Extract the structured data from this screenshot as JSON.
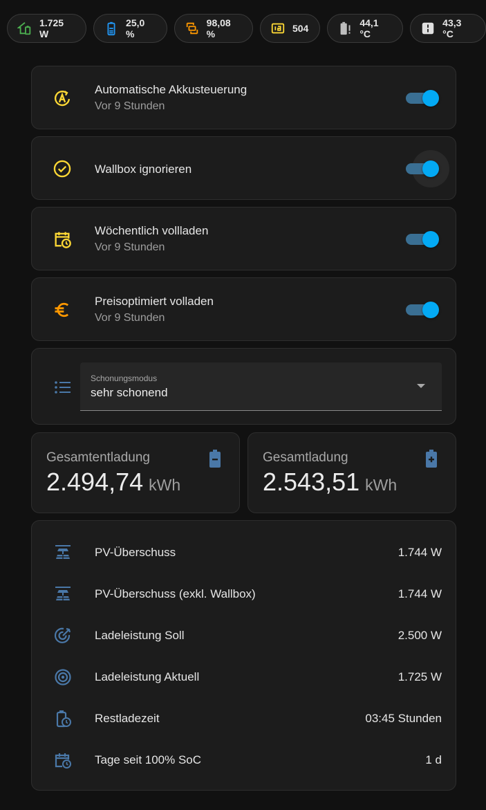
{
  "chips": [
    {
      "icon": "home-battery-icon",
      "value": "1.725 W"
    },
    {
      "icon": "battery-level-icon",
      "value": "25,0 %"
    },
    {
      "icon": "battery-sync-icon",
      "value": "98,08 %"
    },
    {
      "icon": "battery-cycle-icon",
      "value": "504"
    },
    {
      "icon": "battery-alert-icon",
      "value": "44,1 °C"
    },
    {
      "icon": "inverter-icon",
      "value": "43,3 °C"
    }
  ],
  "toggles": [
    {
      "icon": "auto-icon",
      "title": "Automatische Akkusteuerung",
      "subtitle": "Vor 9 Stunden",
      "state": "on"
    },
    {
      "icon": "check-circle-icon",
      "title": "Wallbox ignorieren",
      "subtitle": "",
      "state": "on"
    },
    {
      "icon": "calendar-clock-icon",
      "title": "Wöchentlich vollladen",
      "subtitle": "Vor 9 Stunden",
      "state": "on"
    },
    {
      "icon": "euro-icon",
      "title": "Preisoptimiert volladen",
      "subtitle": "Vor 9 Stunden",
      "state": "on"
    }
  ],
  "select": {
    "icon": "list-icon",
    "label": "Schonungsmodus",
    "value": "sehr schonend"
  },
  "energy": [
    {
      "name": "Gesamtentladung",
      "value": "2.494,74",
      "unit": "kWh",
      "icon": "battery-minus-icon"
    },
    {
      "name": "Gesamtladung",
      "value": "2.543,51",
      "unit": "kWh",
      "icon": "battery-plus-icon"
    }
  ],
  "rows": [
    {
      "icon": "solar-panel-icon",
      "label": "PV-Überschuss",
      "value": "1.744 W"
    },
    {
      "icon": "solar-panel-icon",
      "label": "PV-Überschuss (exkl. Wallbox)",
      "value": "1.744 W"
    },
    {
      "icon": "target-arrow-icon",
      "label": "Ladeleistung Soll",
      "value": "2.500 W"
    },
    {
      "icon": "target-icon",
      "label": "Ladeleistung Aktuell",
      "value": "1.725 W"
    },
    {
      "icon": "clock-battery-icon",
      "label": "Restladezeit",
      "value": "03:45 Stunden"
    },
    {
      "icon": "calendar-clock-icon",
      "label": "Tage seit 100% SoC",
      "value": "1 d"
    }
  ],
  "colors": {
    "background": "#111111",
    "card": "#1c1c1c",
    "accent": "#03a9f4",
    "icon_yellow": "#fdd835",
    "icon_orange": "#ff9800",
    "icon_blue": "#4a78a8",
    "icon_green": "#4caf50"
  }
}
